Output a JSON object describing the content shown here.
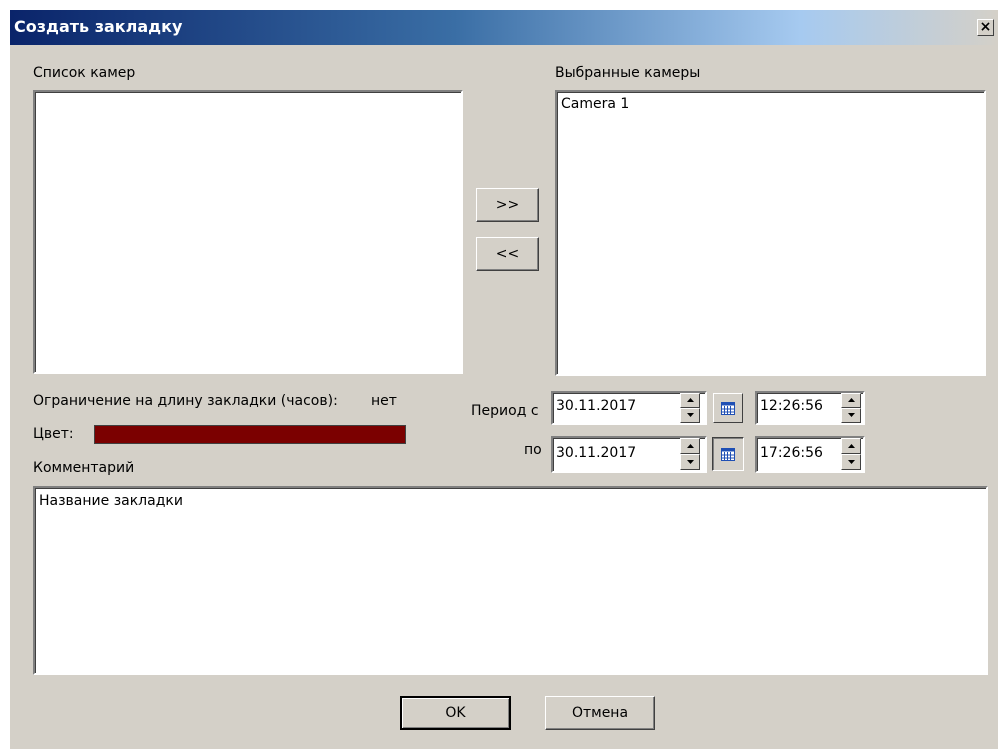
{
  "dialog": {
    "title": "Создать закладку",
    "close_glyph": "×"
  },
  "cameras": {
    "list_label": "Список камер",
    "list_items": [],
    "selected_label": "Выбранные камеры",
    "selected_items": [
      "Camera 1"
    ],
    "add_button": ">>",
    "remove_button": "<<"
  },
  "limit": {
    "label": "Ограничение на длину закладки (часов):",
    "value": "нет"
  },
  "color": {
    "label": "Цвет:",
    "value": "#7b0000"
  },
  "period": {
    "from_label": "Период с",
    "to_label": "по",
    "from_date": "30.11.2017",
    "from_time": "12:26:56",
    "to_date": "30.11.2017",
    "to_time": "17:26:56"
  },
  "comment": {
    "label": "Комментарий",
    "value": "Название закладки"
  },
  "buttons": {
    "ok": "OK",
    "cancel": "Отмена"
  }
}
